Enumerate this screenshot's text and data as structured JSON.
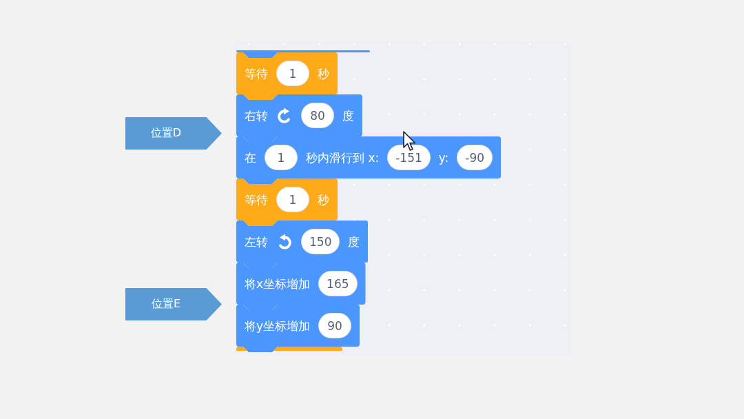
{
  "callouts": [
    {
      "label": "位置D"
    },
    {
      "label": "位置E"
    }
  ],
  "script": {
    "top_edge": {
      "color": "#4c97ff"
    },
    "blocks": [
      {
        "color": "#ffab19",
        "parts": [
          {
            "kind": "label",
            "text": "等待"
          },
          {
            "kind": "number",
            "text": "1"
          },
          {
            "kind": "label",
            "text": "秒"
          }
        ]
      },
      {
        "color": "#4c97ff",
        "parts": [
          {
            "kind": "label",
            "text": "右转"
          },
          {
            "kind": "clockwise"
          },
          {
            "kind": "number",
            "text": "80"
          },
          {
            "kind": "label",
            "text": "度"
          }
        ]
      },
      {
        "color": "#4c97ff",
        "parts": [
          {
            "kind": "label",
            "text": "在"
          },
          {
            "kind": "number",
            "text": "1"
          },
          {
            "kind": "label",
            "text": "秒内滑行到 x:"
          },
          {
            "kind": "number",
            "text": "-151"
          },
          {
            "kind": "label",
            "text": "y:"
          },
          {
            "kind": "number",
            "text": "-90"
          }
        ]
      },
      {
        "color": "#ffab19",
        "parts": [
          {
            "kind": "label",
            "text": "等待"
          },
          {
            "kind": "number",
            "text": "1"
          },
          {
            "kind": "label",
            "text": "秒"
          }
        ]
      },
      {
        "color": "#4c97ff",
        "parts": [
          {
            "kind": "label",
            "text": "左转"
          },
          {
            "kind": "counterclockwise"
          },
          {
            "kind": "number",
            "text": "150"
          },
          {
            "kind": "label",
            "text": "度"
          }
        ]
      },
      {
        "color": "#4c97ff",
        "parts": [
          {
            "kind": "label",
            "text": "将x坐标增加"
          },
          {
            "kind": "number",
            "text": "165"
          }
        ]
      },
      {
        "color": "#4c97ff",
        "parts": [
          {
            "kind": "label",
            "text": "将y坐标增加"
          },
          {
            "kind": "number",
            "text": "90"
          }
        ]
      }
    ],
    "bottom_edge": {
      "color": "#ffab19"
    }
  }
}
